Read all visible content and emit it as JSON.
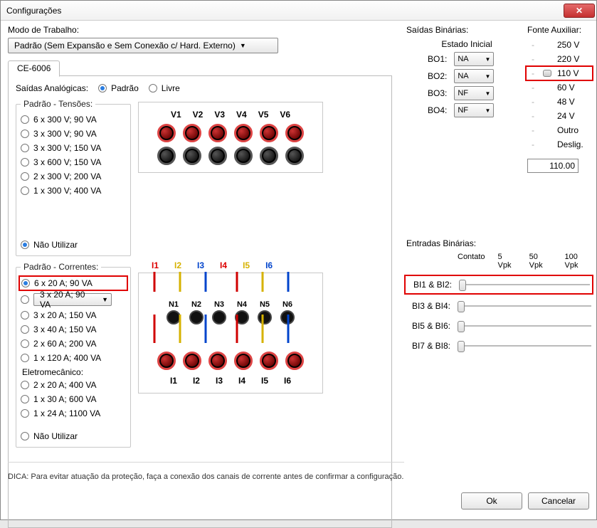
{
  "window": {
    "title": "Configurações"
  },
  "workmode": {
    "label": "Modo de Trabalho:",
    "value": "Padrão (Sem Expansão e Sem Conexão c/ Hard. Externo)"
  },
  "tab": {
    "label": "CE-6006"
  },
  "analog": {
    "title": "Saídas Analógicas:",
    "opt_padrao": "Padrão",
    "opt_livre": "Livre"
  },
  "tensoes": {
    "legend": "Padrão - Tensões:",
    "items": [
      "6 x 300 V; 90 VA",
      "3 x 300 V; 90 VA",
      "3 x 300 V; 150 VA",
      "3 x 600 V; 150 VA",
      "2 x 300 V; 200 VA",
      "1 x 300 V; 400 VA"
    ],
    "nao_utilizar": "Não Utilizar"
  },
  "vlabels": [
    "V1",
    "V2",
    "V3",
    "V4",
    "V5",
    "V6"
  ],
  "correntes": {
    "legend": "Padrão - Correntes:",
    "items": [
      "6 x 20 A; 90 VA",
      "3 x 20 A; 90 VA",
      "3 x 20 A; 150 VA",
      "3 x 40 A; 150 VA",
      "2 x 60 A; 200 VA",
      "1 x 120 A; 400 VA"
    ],
    "elet_title": "Eletromecânico:",
    "elet_items": [
      "2 x 20 A; 400 VA",
      "1 x 30 A; 600 VA",
      "1 x 24 A; 1100 VA"
    ],
    "nao_utilizar": "Não Utilizar"
  },
  "ilabels": [
    "I1",
    "I2",
    "I3",
    "I4",
    "I5",
    "I6"
  ],
  "nlabels": [
    "N1",
    "N2",
    "N3",
    "N4",
    "N5",
    "N6"
  ],
  "saidas_bin": {
    "title": "Saídas Binárias:",
    "subtitle": "Estado Inicial",
    "rows": [
      {
        "name": "BO1:",
        "val": "NA"
      },
      {
        "name": "BO2:",
        "val": "NA"
      },
      {
        "name": "BO3:",
        "val": "NF"
      },
      {
        "name": "BO4:",
        "val": "NF"
      }
    ]
  },
  "fonte": {
    "title": "Fonte Auxiliar:",
    "items": [
      "250 V",
      "220 V",
      "110 V",
      "60 V",
      "48 V",
      "24 V",
      "Outro",
      "Deslig."
    ],
    "selected_index": 2,
    "value": "110.00"
  },
  "entradas": {
    "title": "Entradas Binárias:",
    "cols": [
      "Contato",
      "5 Vpk",
      "50 Vpk",
      "100 Vpk"
    ],
    "rows": [
      "BI1 & BI2:",
      "BI3 & BI4:",
      "BI5 & BI6:",
      "BI7 & BI8:"
    ]
  },
  "tip": "DICA: Para evitar atuação da proteção, faça a conexão dos canais de corrente antes de confirmar a configuração.",
  "buttons": {
    "ok": "Ok",
    "cancel": "Cancelar"
  }
}
